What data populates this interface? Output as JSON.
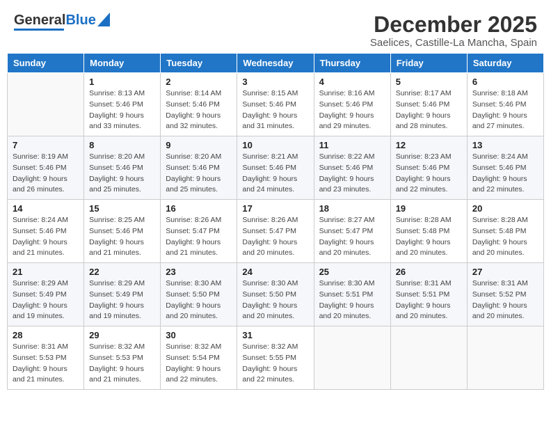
{
  "header": {
    "logo_general": "General",
    "logo_blue": "Blue",
    "title": "December 2025",
    "subtitle": "Saelices, Castille-La Mancha, Spain"
  },
  "calendar": {
    "days_of_week": [
      "Sunday",
      "Monday",
      "Tuesday",
      "Wednesday",
      "Thursday",
      "Friday",
      "Saturday"
    ],
    "weeks": [
      [
        {
          "day": "",
          "sunrise": "",
          "sunset": "",
          "daylight": ""
        },
        {
          "day": "1",
          "sunrise": "Sunrise: 8:13 AM",
          "sunset": "Sunset: 5:46 PM",
          "daylight": "Daylight: 9 hours and 33 minutes."
        },
        {
          "day": "2",
          "sunrise": "Sunrise: 8:14 AM",
          "sunset": "Sunset: 5:46 PM",
          "daylight": "Daylight: 9 hours and 32 minutes."
        },
        {
          "day": "3",
          "sunrise": "Sunrise: 8:15 AM",
          "sunset": "Sunset: 5:46 PM",
          "daylight": "Daylight: 9 hours and 31 minutes."
        },
        {
          "day": "4",
          "sunrise": "Sunrise: 8:16 AM",
          "sunset": "Sunset: 5:46 PM",
          "daylight": "Daylight: 9 hours and 29 minutes."
        },
        {
          "day": "5",
          "sunrise": "Sunrise: 8:17 AM",
          "sunset": "Sunset: 5:46 PM",
          "daylight": "Daylight: 9 hours and 28 minutes."
        },
        {
          "day": "6",
          "sunrise": "Sunrise: 8:18 AM",
          "sunset": "Sunset: 5:46 PM",
          "daylight": "Daylight: 9 hours and 27 minutes."
        }
      ],
      [
        {
          "day": "7",
          "sunrise": "Sunrise: 8:19 AM",
          "sunset": "Sunset: 5:46 PM",
          "daylight": "Daylight: 9 hours and 26 minutes."
        },
        {
          "day": "8",
          "sunrise": "Sunrise: 8:20 AM",
          "sunset": "Sunset: 5:46 PM",
          "daylight": "Daylight: 9 hours and 25 minutes."
        },
        {
          "day": "9",
          "sunrise": "Sunrise: 8:20 AM",
          "sunset": "Sunset: 5:46 PM",
          "daylight": "Daylight: 9 hours and 25 minutes."
        },
        {
          "day": "10",
          "sunrise": "Sunrise: 8:21 AM",
          "sunset": "Sunset: 5:46 PM",
          "daylight": "Daylight: 9 hours and 24 minutes."
        },
        {
          "day": "11",
          "sunrise": "Sunrise: 8:22 AM",
          "sunset": "Sunset: 5:46 PM",
          "daylight": "Daylight: 9 hours and 23 minutes."
        },
        {
          "day": "12",
          "sunrise": "Sunrise: 8:23 AM",
          "sunset": "Sunset: 5:46 PM",
          "daylight": "Daylight: 9 hours and 22 minutes."
        },
        {
          "day": "13",
          "sunrise": "Sunrise: 8:24 AM",
          "sunset": "Sunset: 5:46 PM",
          "daylight": "Daylight: 9 hours and 22 minutes."
        }
      ],
      [
        {
          "day": "14",
          "sunrise": "Sunrise: 8:24 AM",
          "sunset": "Sunset: 5:46 PM",
          "daylight": "Daylight: 9 hours and 21 minutes."
        },
        {
          "day": "15",
          "sunrise": "Sunrise: 8:25 AM",
          "sunset": "Sunset: 5:46 PM",
          "daylight": "Daylight: 9 hours and 21 minutes."
        },
        {
          "day": "16",
          "sunrise": "Sunrise: 8:26 AM",
          "sunset": "Sunset: 5:47 PM",
          "daylight": "Daylight: 9 hours and 21 minutes."
        },
        {
          "day": "17",
          "sunrise": "Sunrise: 8:26 AM",
          "sunset": "Sunset: 5:47 PM",
          "daylight": "Daylight: 9 hours and 20 minutes."
        },
        {
          "day": "18",
          "sunrise": "Sunrise: 8:27 AM",
          "sunset": "Sunset: 5:47 PM",
          "daylight": "Daylight: 9 hours and 20 minutes."
        },
        {
          "day": "19",
          "sunrise": "Sunrise: 8:28 AM",
          "sunset": "Sunset: 5:48 PM",
          "daylight": "Daylight: 9 hours and 20 minutes."
        },
        {
          "day": "20",
          "sunrise": "Sunrise: 8:28 AM",
          "sunset": "Sunset: 5:48 PM",
          "daylight": "Daylight: 9 hours and 20 minutes."
        }
      ],
      [
        {
          "day": "21",
          "sunrise": "Sunrise: 8:29 AM",
          "sunset": "Sunset: 5:49 PM",
          "daylight": "Daylight: 9 hours and 19 minutes."
        },
        {
          "day": "22",
          "sunrise": "Sunrise: 8:29 AM",
          "sunset": "Sunset: 5:49 PM",
          "daylight": "Daylight: 9 hours and 19 minutes."
        },
        {
          "day": "23",
          "sunrise": "Sunrise: 8:30 AM",
          "sunset": "Sunset: 5:50 PM",
          "daylight": "Daylight: 9 hours and 20 minutes."
        },
        {
          "day": "24",
          "sunrise": "Sunrise: 8:30 AM",
          "sunset": "Sunset: 5:50 PM",
          "daylight": "Daylight: 9 hours and 20 minutes."
        },
        {
          "day": "25",
          "sunrise": "Sunrise: 8:30 AM",
          "sunset": "Sunset: 5:51 PM",
          "daylight": "Daylight: 9 hours and 20 minutes."
        },
        {
          "day": "26",
          "sunrise": "Sunrise: 8:31 AM",
          "sunset": "Sunset: 5:51 PM",
          "daylight": "Daylight: 9 hours and 20 minutes."
        },
        {
          "day": "27",
          "sunrise": "Sunrise: 8:31 AM",
          "sunset": "Sunset: 5:52 PM",
          "daylight": "Daylight: 9 hours and 20 minutes."
        }
      ],
      [
        {
          "day": "28",
          "sunrise": "Sunrise: 8:31 AM",
          "sunset": "Sunset: 5:53 PM",
          "daylight": "Daylight: 9 hours and 21 minutes."
        },
        {
          "day": "29",
          "sunrise": "Sunrise: 8:32 AM",
          "sunset": "Sunset: 5:53 PM",
          "daylight": "Daylight: 9 hours and 21 minutes."
        },
        {
          "day": "30",
          "sunrise": "Sunrise: 8:32 AM",
          "sunset": "Sunset: 5:54 PM",
          "daylight": "Daylight: 9 hours and 22 minutes."
        },
        {
          "day": "31",
          "sunrise": "Sunrise: 8:32 AM",
          "sunset": "Sunset: 5:55 PM",
          "daylight": "Daylight: 9 hours and 22 minutes."
        },
        {
          "day": "",
          "sunrise": "",
          "sunset": "",
          "daylight": ""
        },
        {
          "day": "",
          "sunrise": "",
          "sunset": "",
          "daylight": ""
        },
        {
          "day": "",
          "sunrise": "",
          "sunset": "",
          "daylight": ""
        }
      ]
    ]
  }
}
